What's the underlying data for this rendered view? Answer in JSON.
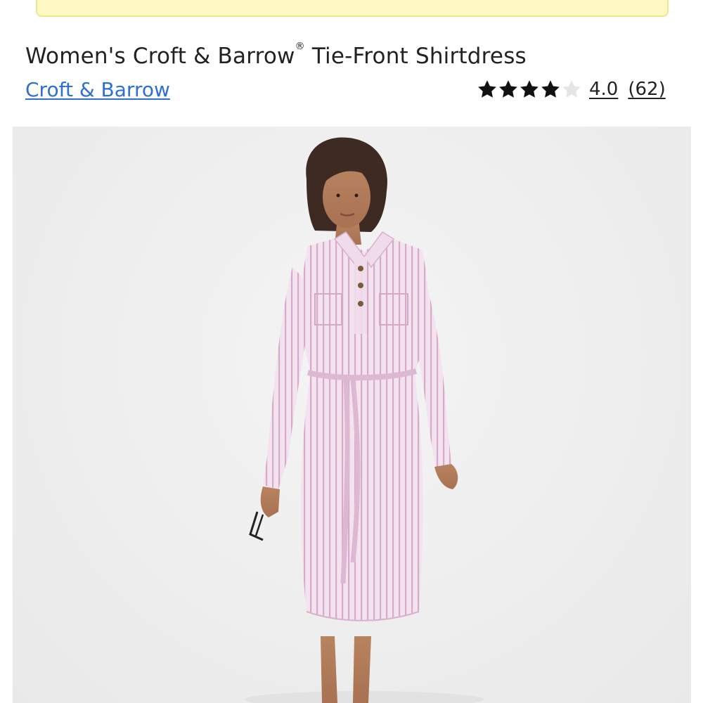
{
  "product": {
    "title_main": "Women's Croft & Barrow",
    "title_reg": "®",
    "title_rest": " Tie-Front Shirtdress",
    "brand": "Croft & Barrow"
  },
  "rating": {
    "value": "4.0",
    "count": "(62)",
    "stars_filled": 4,
    "stars_total": 5
  },
  "colors": {
    "link": "#2e6fd4",
    "banner_bg": "#fdf7c3",
    "star_filled": "#111111",
    "star_empty": "#e6e6e6",
    "dress": "#ecd3e6"
  },
  "image": {
    "subject": "model wearing pink striped tie-front shirtdress"
  }
}
